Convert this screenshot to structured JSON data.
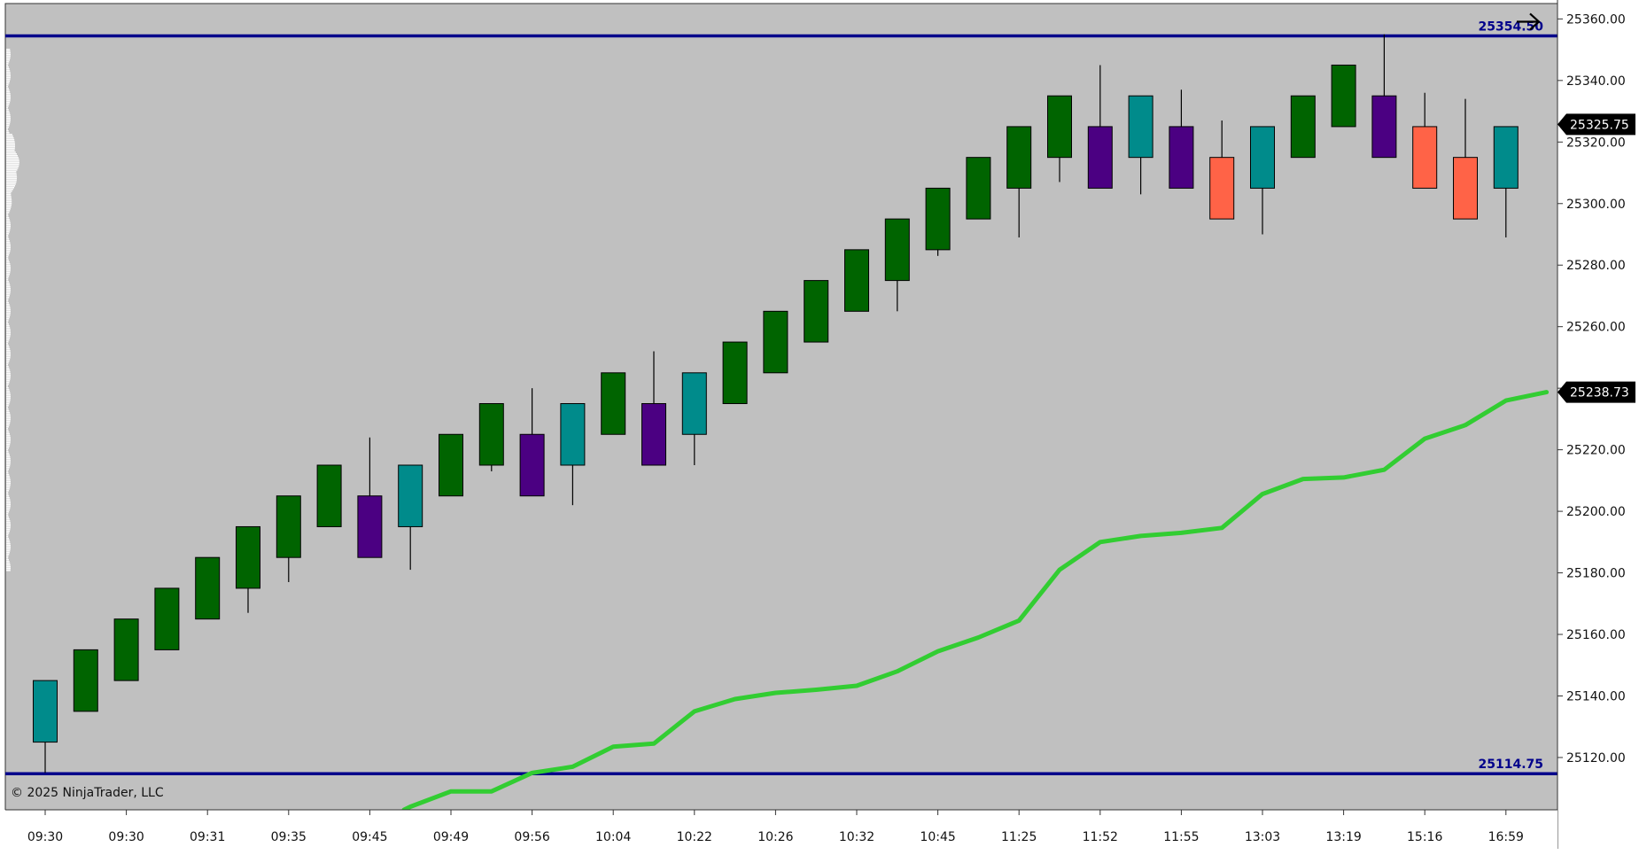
{
  "colors": {
    "background": "#c0c0c0",
    "axis_background": "#ffffff",
    "bull": "#006400",
    "bull_alt": "#008b8b",
    "bear": "#4b0082",
    "bear_alt": "#ff6347",
    "level_line": "#00008b",
    "average_line": "#32cd32",
    "marker": "#000000"
  },
  "copyright": "© 2025 NinjaTrader, LLC",
  "marker_icon": "arrow-right-icon",
  "chart_data": {
    "type": "candlestick",
    "ylim": [
      25103,
      25365
    ],
    "y_ticks": [
      25120,
      25140,
      25160,
      25180,
      25200,
      25220,
      25240,
      25260,
      25280,
      25300,
      25320,
      25340,
      25360
    ],
    "y_tick_labels": [
      "25120.00",
      "25140.00",
      "25160.00",
      "25180.00",
      "25200.00",
      "25220.00",
      "25240.00",
      "25260.00",
      "25280.00",
      "25300.00",
      "25320.00",
      "25340.00",
      "25360.00"
    ],
    "x_tick_labels": [
      "09:30",
      "09:30",
      "09:31",
      "09:35",
      "09:45",
      "09:49",
      "09:56",
      "10:04",
      "10:22",
      "10:26",
      "10:32",
      "10:45",
      "11:25",
      "11:52",
      "11:55",
      "13:03",
      "13:19",
      "15:16",
      "16:59"
    ],
    "candles": [
      {
        "o": 25125,
        "h": 25145,
        "l": 25115,
        "c": 25145,
        "color": "#008b8b"
      },
      {
        "o": 25135,
        "h": 25155,
        "l": 25135,
        "c": 25155,
        "color": "#006400"
      },
      {
        "o": 25145,
        "h": 25165,
        "l": 25145,
        "c": 25165,
        "color": "#006400"
      },
      {
        "o": 25155,
        "h": 25175,
        "l": 25155,
        "c": 25175,
        "color": "#006400"
      },
      {
        "o": 25165,
        "h": 25185,
        "l": 25165,
        "c": 25185,
        "color": "#006400"
      },
      {
        "o": 25175,
        "h": 25195,
        "l": 25167,
        "c": 25195,
        "color": "#006400"
      },
      {
        "o": 25185,
        "h": 25205,
        "l": 25177,
        "c": 25205,
        "color": "#006400"
      },
      {
        "o": 25195,
        "h": 25215,
        "l": 25195,
        "c": 25215,
        "color": "#006400"
      },
      {
        "o": 25205,
        "h": 25224,
        "l": 25185,
        "c": 25185,
        "color": "#4b0082"
      },
      {
        "o": 25195,
        "h": 25215,
        "l": 25181,
        "c": 25215,
        "color": "#008b8b"
      },
      {
        "o": 25205,
        "h": 25225,
        "l": 25205,
        "c": 25225,
        "color": "#006400"
      },
      {
        "o": 25215,
        "h": 25235,
        "l": 25213,
        "c": 25235,
        "color": "#006400"
      },
      {
        "o": 25225,
        "h": 25240,
        "l": 25205,
        "c": 25205,
        "color": "#4b0082"
      },
      {
        "o": 25215,
        "h": 25235,
        "l": 25202,
        "c": 25235,
        "color": "#008b8b"
      },
      {
        "o": 25225,
        "h": 25245,
        "l": 25225,
        "c": 25245,
        "color": "#006400"
      },
      {
        "o": 25235,
        "h": 25252,
        "l": 25215,
        "c": 25215,
        "color": "#4b0082"
      },
      {
        "o": 25225,
        "h": 25245,
        "l": 25215,
        "c": 25245,
        "color": "#008b8b"
      },
      {
        "o": 25235,
        "h": 25255,
        "l": 25235,
        "c": 25255,
        "color": "#006400"
      },
      {
        "o": 25245,
        "h": 25265,
        "l": 25245,
        "c": 25265,
        "color": "#006400"
      },
      {
        "o": 25255,
        "h": 25275,
        "l": 25255,
        "c": 25275,
        "color": "#006400"
      },
      {
        "o": 25265,
        "h": 25285,
        "l": 25265,
        "c": 25285,
        "color": "#006400"
      },
      {
        "o": 25275,
        "h": 25295,
        "l": 25265,
        "c": 25295,
        "color": "#006400"
      },
      {
        "o": 25285,
        "h": 25305,
        "l": 25283,
        "c": 25305,
        "color": "#006400"
      },
      {
        "o": 25295,
        "h": 25315,
        "l": 25295,
        "c": 25315,
        "color": "#006400"
      },
      {
        "o": 25305,
        "h": 25325,
        "l": 25289,
        "c": 25325,
        "color": "#006400"
      },
      {
        "o": 25315,
        "h": 25335,
        "l": 25307,
        "c": 25335,
        "color": "#006400"
      },
      {
        "o": 25325,
        "h": 25345,
        "l": 25305,
        "c": 25305,
        "color": "#4b0082"
      },
      {
        "o": 25315,
        "h": 25335,
        "l": 25303,
        "c": 25335,
        "color": "#008b8b"
      },
      {
        "o": 25325,
        "h": 25337,
        "l": 25305,
        "c": 25305,
        "color": "#4b0082"
      },
      {
        "o": 25315,
        "h": 25327,
        "l": 25295,
        "c": 25295,
        "color": "#ff6347"
      },
      {
        "o": 25305,
        "h": 25325,
        "l": 25290,
        "c": 25325,
        "color": "#008b8b"
      },
      {
        "o": 25315,
        "h": 25335,
        "l": 25315,
        "c": 25335,
        "color": "#006400"
      },
      {
        "o": 25325,
        "h": 25345,
        "l": 25325,
        "c": 25345,
        "color": "#006400"
      },
      {
        "o": 25335,
        "h": 25355,
        "l": 25315,
        "c": 25315,
        "color": "#4b0082"
      },
      {
        "o": 25325,
        "h": 25336,
        "l": 25305,
        "c": 25305,
        "color": "#ff6347"
      },
      {
        "o": 25315,
        "h": 25334,
        "l": 25295,
        "c": 25295,
        "color": "#ff6347"
      },
      {
        "o": 25305,
        "h": 25325,
        "l": 25289,
        "c": 25325,
        "color": "#008b8b"
      }
    ],
    "average_line": [
      25097.6,
      25104.0,
      25109.0,
      25109.0,
      25115.0,
      25117.0,
      25123.5,
      25124.5,
      25135.0,
      25139.0,
      25141.0,
      25142.0,
      25143.3,
      25148.0,
      25154.5,
      25159.0,
      25164.5,
      25181.0,
      25190.0,
      25192.0,
      25193.0,
      25194.6,
      25205.6,
      25210.5,
      25211.0,
      25213.5,
      25223.6,
      25228.0,
      25236.0,
      25238.73
    ],
    "average_line_start_index": 8,
    "levels": [
      {
        "value": 25354.5,
        "label": "25354.50"
      },
      {
        "value": 25114.75,
        "label": "25114.75"
      }
    ],
    "price_markers": [
      {
        "value": 25325.75,
        "label": "25325.75"
      },
      {
        "value": 25238.73,
        "label": "25238.73"
      }
    ]
  }
}
